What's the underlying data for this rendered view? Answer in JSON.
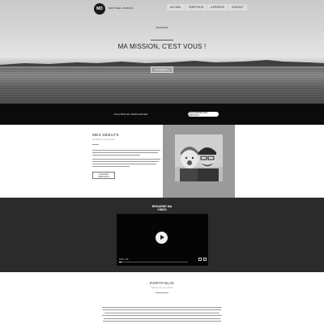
{
  "header": {
    "logo_text": "MD",
    "brand_name": "MATTHIEU DUBOIS",
    "nav": [
      "ACCUEIL",
      "PORTFOLIO",
      "A PROPOS",
      "CONTACT"
    ]
  },
  "hero": {
    "eyebrow": "BIENVENUE",
    "title": "MA MISSION, C'EST VOUS !",
    "button": "EN SAVOIR +"
  },
  "cta_bar": {
    "text": "VOUS ÊTES EN TÉLÉCHARGER",
    "button": "TÉLÉCHARGER MON PORTFOLIO"
  },
  "debuts": {
    "title": "MES DÉBUTS",
    "subtitle": "Le chemin vers la photo",
    "button": "VOIR MON PORTFOLIO"
  },
  "video": {
    "title_line1": "REGARDE MA",
    "title_line2": "VIDEO",
    "time": "0:00 / 1:15"
  },
  "portfolio": {
    "title": "PORTFOLIO",
    "subtitle": "Découvrez mes photos"
  },
  "colors": {
    "dark_bar": "#0b0b0b",
    "video_bg": "#2b2b2b",
    "photo_bg": "#9a9a9a"
  }
}
